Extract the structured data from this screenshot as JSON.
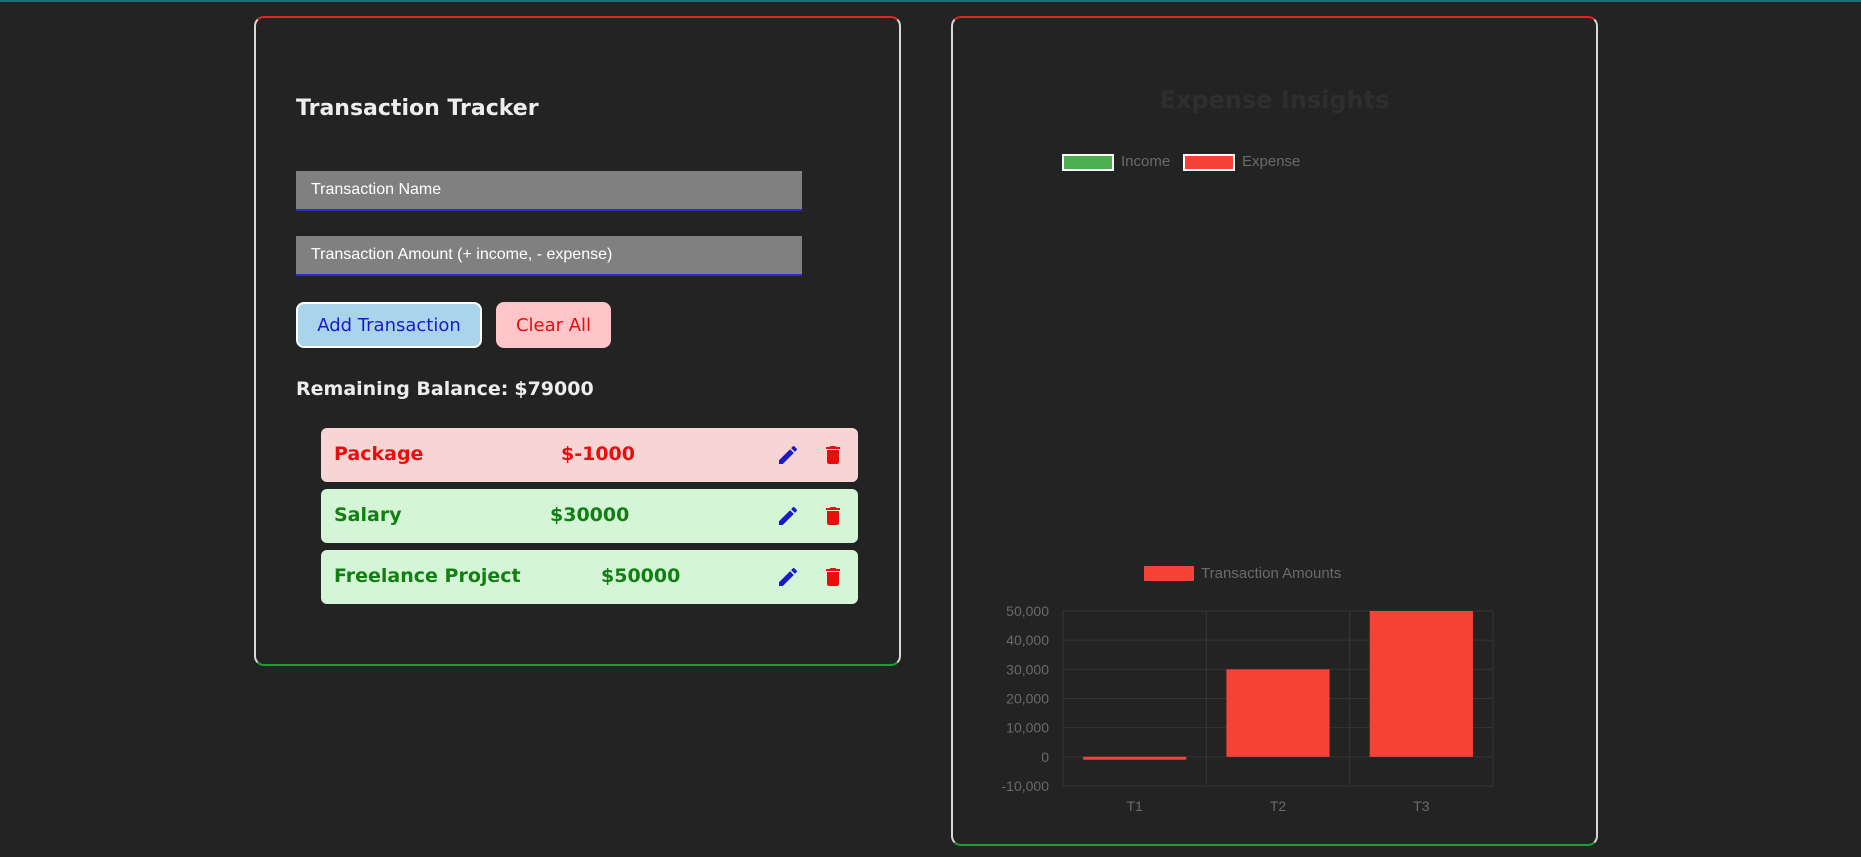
{
  "tracker": {
    "title": "Transaction Tracker",
    "name_placeholder": "Transaction Name",
    "amount_placeholder": "Transaction Amount (+ income, - expense)",
    "add_label": "Add Transaction",
    "clear_label": "Clear All",
    "balance_label": "Remaining Balance:",
    "balance_value": "$79000",
    "transactions": [
      {
        "name": "Package",
        "amount": "$-1000",
        "type": "expense"
      },
      {
        "name": "Salary",
        "amount": "$30000",
        "type": "income"
      },
      {
        "name": "Freelance Project",
        "amount": "$50000",
        "type": "income"
      }
    ]
  },
  "insights": {
    "title": "Expense Insights",
    "legend": [
      "Income",
      "Expense"
    ]
  },
  "colors": {
    "income": "#4caf50",
    "expense": "#f44336",
    "accent": "#1a1acb"
  },
  "icons": {
    "edit": "pencil-icon",
    "delete": "trash-icon"
  },
  "chart_data": {
    "type": "bar",
    "categories": [
      "T1",
      "T2",
      "T3"
    ],
    "series": [
      {
        "name": "Transaction Amounts",
        "values": [
          -1000,
          30000,
          50000
        ]
      }
    ],
    "ylim": [
      -10000,
      50000
    ],
    "yticks": [
      "50,000",
      "40,000",
      "30,000",
      "20,000",
      "10,000",
      "0",
      "-10,000"
    ],
    "grid": true,
    "legend": "top"
  }
}
